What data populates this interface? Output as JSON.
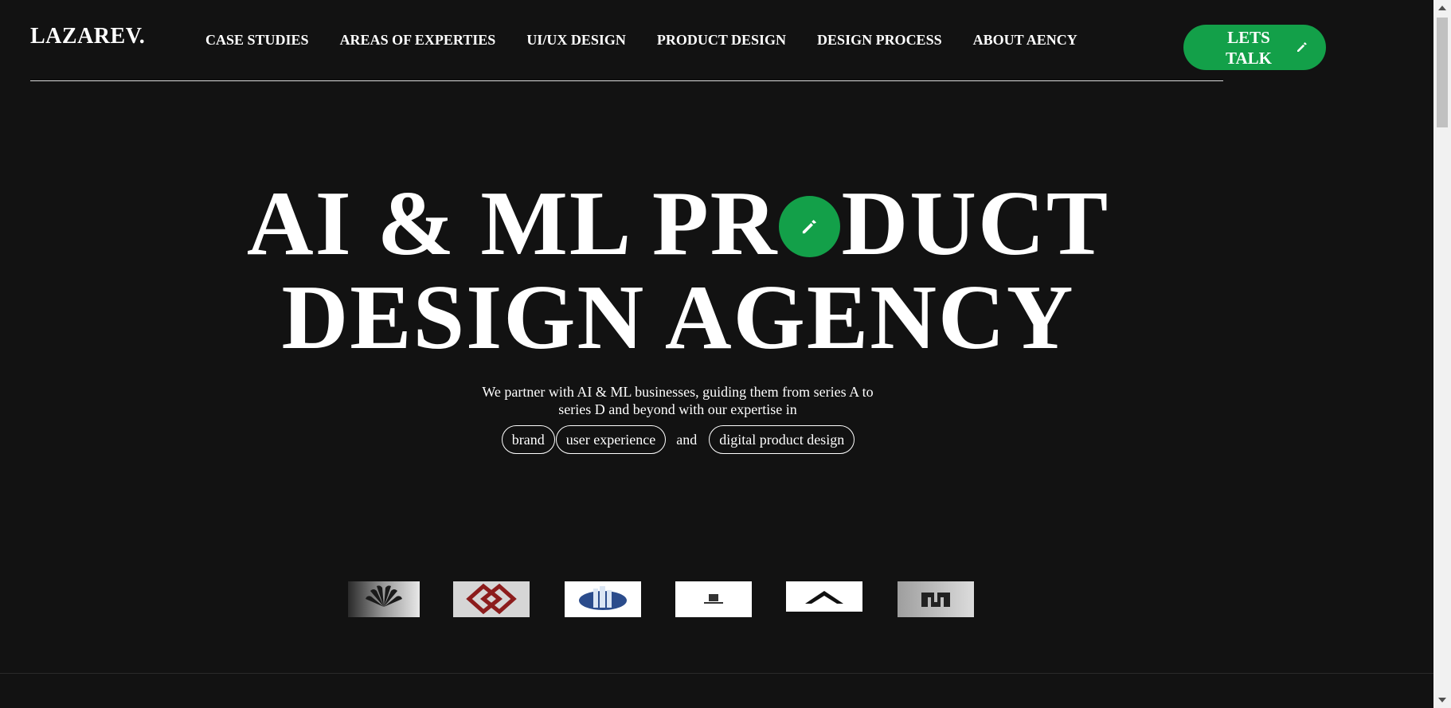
{
  "header": {
    "logo": "LAZAREV.",
    "nav": [
      "CASE STUDIES",
      "AREAS OF EXPERTIES",
      "UI/UX DESIGN",
      "PRODUCT DESIGN",
      "DESIGN PROCESS",
      "ABOUT AENCY"
    ],
    "cta_label": "LETS TALK",
    "cta_icon": "pencil-icon"
  },
  "hero": {
    "title_line1_part1": "AI & ML PR",
    "title_line1_part2": "DUCT",
    "title_line2": "DESIGN AGENCY",
    "badge_icon": "pencil-icon",
    "subtitle": "We partner with AI & ML businesses, guiding them from series A to series D and beyond with our expertise in",
    "pills": [
      "brand",
      "user experience",
      "digital product design"
    ],
    "connector": "and"
  },
  "client_logos": [
    {
      "name": "huawei-logo",
      "text": "HUAWEI"
    },
    {
      "name": "red-diamond-logo"
    },
    {
      "name": "blue-building-logo"
    },
    {
      "name": "black-emblem-logo"
    },
    {
      "name": "black-chevron-logo"
    },
    {
      "name": "grey-n-logo"
    }
  ],
  "colors": {
    "background": "#121212",
    "accent": "#13a049",
    "text": "#ffffff"
  }
}
